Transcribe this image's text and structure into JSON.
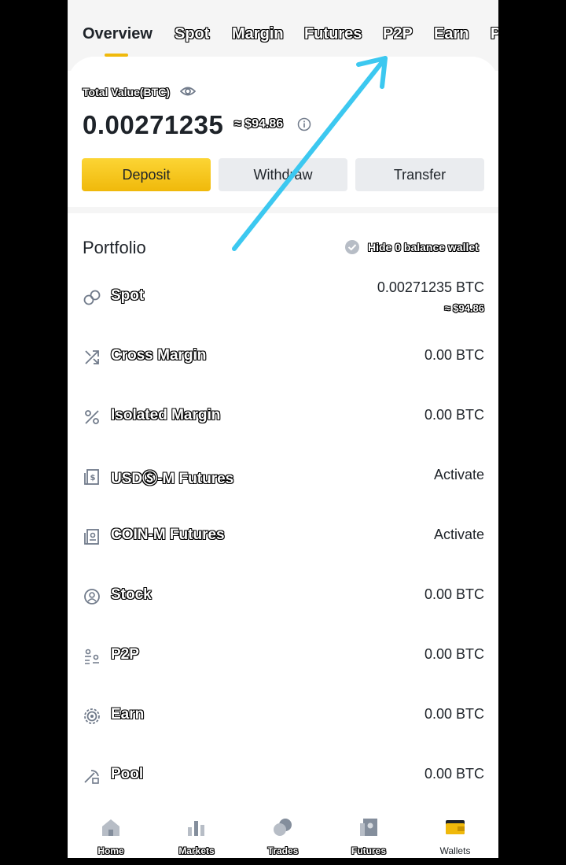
{
  "tabs": [
    {
      "label": "Overview",
      "active": true
    },
    {
      "label": "Spot"
    },
    {
      "label": "Margin"
    },
    {
      "label": "Futures"
    },
    {
      "label": "P2P"
    },
    {
      "label": "Earn"
    },
    {
      "label": "P"
    }
  ],
  "total": {
    "label": "Total Value(BTC)",
    "btc": "0.00271235",
    "usd": "≈ $94.86"
  },
  "actions": {
    "deposit": "Deposit",
    "withdraw": "Withdraw",
    "transfer": "Transfer"
  },
  "portfolio": {
    "title": "Portfolio",
    "hide_label": "Hide 0 balance wallet",
    "rows": [
      {
        "icon": "spot-icon",
        "label": "Spot",
        "value": "0.00271235 BTC",
        "sub": "≈ $94.86"
      },
      {
        "icon": "cross-margin-icon",
        "label": "Cross Margin",
        "value": "0.00 BTC"
      },
      {
        "icon": "isolated-margin-icon",
        "label": "Isolated Margin",
        "value": "0.00 BTC"
      },
      {
        "icon": "usds-futures-icon",
        "label": "USDⓈ-M Futures",
        "value": "Activate"
      },
      {
        "icon": "coin-futures-icon",
        "label": "COIN-M Futures",
        "value": "Activate"
      },
      {
        "icon": "stock-icon",
        "label": "Stock",
        "value": "0.00 BTC"
      },
      {
        "icon": "p2p-icon",
        "label": "P2P",
        "value": "0.00 BTC"
      },
      {
        "icon": "earn-icon",
        "label": "Earn",
        "value": "0.00 BTC"
      },
      {
        "icon": "pool-icon",
        "label": "Pool",
        "value": "0.00 BTC"
      }
    ]
  },
  "bottom_nav": [
    {
      "label": "Home",
      "icon": "home-icon"
    },
    {
      "label": "Markets",
      "icon": "markets-icon"
    },
    {
      "label": "Trades",
      "icon": "trades-icon"
    },
    {
      "label": "Futures",
      "icon": "futures-icon"
    },
    {
      "label": "Wallets",
      "icon": "wallet-icon",
      "active": true
    }
  ],
  "colors": {
    "accent": "#f0b90b",
    "annotation_arrow": "#3cc8f0",
    "text": "#1e2329",
    "icon_gray": "#707a8a"
  }
}
